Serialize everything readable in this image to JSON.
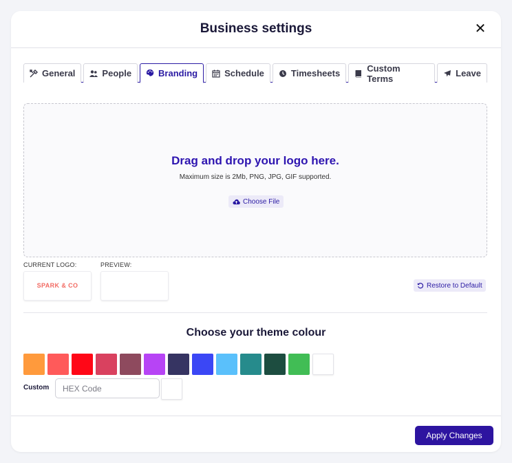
{
  "modal": {
    "title": "Business settings",
    "close_icon": "✕"
  },
  "tabs": [
    {
      "label": "General",
      "icon": "tools-icon"
    },
    {
      "label": "People",
      "icon": "users-icon"
    },
    {
      "label": "Branding",
      "icon": "palette-icon",
      "active": true
    },
    {
      "label": "Schedule",
      "icon": "calendar-icon"
    },
    {
      "label": "Timesheets",
      "icon": "clock-icon"
    },
    {
      "label": "Custom Terms",
      "icon": "book-icon"
    },
    {
      "label": "Leave",
      "icon": "plane-icon"
    }
  ],
  "upload": {
    "title": "Drag and drop your logo here.",
    "subtitle": "Maximum size is 2Mb, PNG, JPG, GIF supported.",
    "choose_label": "Choose File"
  },
  "logo": {
    "current_label": "CURRENT LOGO:",
    "preview_label": "PREVIEW:",
    "current_text": "SPARK & CO",
    "restore_label": "Restore to Default"
  },
  "theme": {
    "title": "Choose your theme colour",
    "swatches": [
      "#ff9a3c",
      "#ff5a5a",
      "#ff0717",
      "#d9415f",
      "#8e4a5e",
      "#b744f5",
      "#363462",
      "#3b47f5",
      "#5ac0fb",
      "#268b8c",
      "#1d4d40",
      "#41bd55",
      "#ffffff"
    ],
    "custom_label": "Custom",
    "hex_placeholder": "HEX Code"
  },
  "footer": {
    "apply_label": "Apply Changes"
  },
  "colors": {
    "accent": "#2d14a0",
    "logo_text": "#f26b63"
  }
}
